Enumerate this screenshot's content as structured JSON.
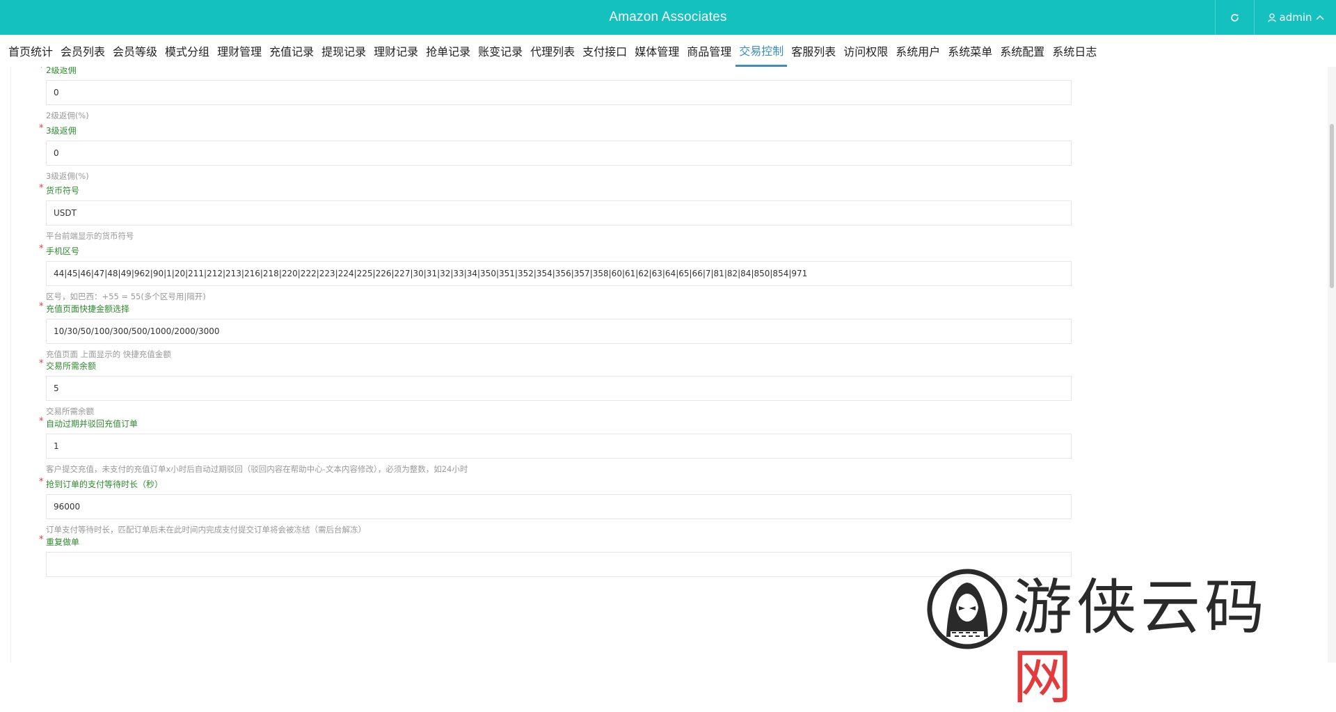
{
  "header": {
    "title": "Amazon Associates",
    "user_label": "admin"
  },
  "nav": {
    "items": [
      "首页统计",
      "会员列表",
      "会员等级",
      "模式分组",
      "理财管理",
      "充值记录",
      "提现记录",
      "理财记录",
      "抢单记录",
      "账变记录",
      "代理列表",
      "支付接口",
      "媒体管理",
      "商品管理",
      "交易控制",
      "客服列表",
      "访问权限",
      "系统用户",
      "系统菜单",
      "系统配置",
      "系统日志"
    ],
    "active": "交易控制"
  },
  "form": {
    "fields": [
      {
        "label": "2级返佣",
        "value": "0",
        "help": "2级返佣(%)"
      },
      {
        "label": "3级返佣",
        "value": "0",
        "help": "3级返佣(%)"
      },
      {
        "label": "货币符号",
        "value": "USDT",
        "help": "平台前端显示的货币符号"
      },
      {
        "label": "手机区号",
        "value": "44|45|46|47|48|49|962|90|1|20|211|212|213|216|218|220|222|223|224|225|226|227|30|31|32|33|34|350|351|352|354|356|357|358|60|61|62|63|64|65|66|7|81|82|84|850|854|971",
        "help": "区号，如巴西：+55 = 55(多个区号用|隔开)"
      },
      {
        "label": "充值页面快捷金额选择",
        "value": "10/30/50/100/300/500/1000/2000/3000",
        "help": "充值页面 上面显示的 快捷充值金额"
      },
      {
        "label": "交易所需余额",
        "value": "5",
        "help": "交易所需余额"
      },
      {
        "label": "自动过期并驳回充值订单",
        "value": "1",
        "help": "客户提交充值，未支付的充值订单x小时后自动过期驳回（驳回内容在帮助中心-文本内容修改），必须为整数，如24小时"
      },
      {
        "label": "抢到订单的支付等待时长（秒）",
        "value": "96000",
        "help": "订单支付等待时长，匹配订单后未在此时间内完成支付提交订单将会被冻结（需后台解冻）"
      },
      {
        "label": "重复做单",
        "value": "",
        "help": ""
      }
    ]
  },
  "watermark": {
    "text_main": "游侠云码",
    "text_red": "网"
  },
  "colors": {
    "header_bg": "#14c1bf",
    "nav_active": "#3c8dbc",
    "label_green": "#2e8b2e",
    "required_red": "#e23d3d"
  }
}
